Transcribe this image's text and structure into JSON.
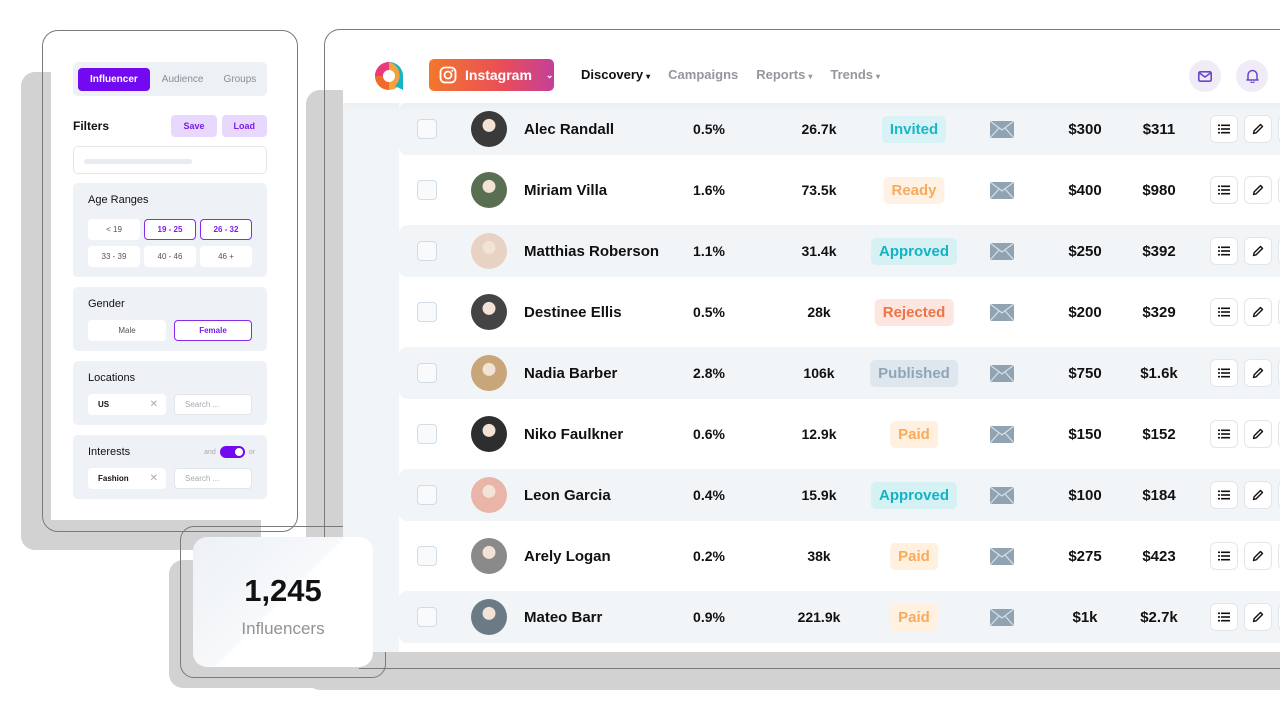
{
  "filters": {
    "tabs": [
      {
        "label": "Influencer",
        "active": true
      },
      {
        "label": "Audience",
        "active": false
      },
      {
        "label": "Groups",
        "active": false
      }
    ],
    "title": "Filters",
    "save_label": "Save",
    "load_label": "Load",
    "age": {
      "title": "Age Ranges",
      "options": [
        {
          "label": "< 19",
          "selected": false
        },
        {
          "label": "19 - 25",
          "selected": true
        },
        {
          "label": "26 - 32",
          "selected": true
        },
        {
          "label": "33 - 39",
          "selected": false
        },
        {
          "label": "40 - 46",
          "selected": false
        },
        {
          "label": "46 +",
          "selected": false
        }
      ]
    },
    "gender": {
      "title": "Gender",
      "options": [
        {
          "label": "Male",
          "selected": false
        },
        {
          "label": "Female",
          "selected": true
        }
      ]
    },
    "locations": {
      "title": "Locations",
      "tag": "US",
      "search_placeholder": "Search ..."
    },
    "interests": {
      "title": "Interests",
      "toggle_left": "and",
      "toggle_right": "or",
      "tag": "Fashion",
      "search_placeholder": "Search ..."
    }
  },
  "counter": {
    "value": "1,245",
    "label": "Influencers"
  },
  "header": {
    "platform": "Instagram",
    "nav": [
      {
        "label": "Discovery",
        "active": true,
        "dropdown": true
      },
      {
        "label": "Campaigns",
        "active": false,
        "dropdown": false
      },
      {
        "label": "Reports",
        "active": false,
        "dropdown": true
      },
      {
        "label": "Trends",
        "active": false,
        "dropdown": true
      }
    ],
    "icons": [
      "mail-icon",
      "bell-icon"
    ]
  },
  "status_colors": {
    "Invited": {
      "bg": "#d9f2f5",
      "fg": "#1bb7c9"
    },
    "Ready": {
      "bg": "#fff1e3",
      "fg": "#f7ab5c"
    },
    "Approved": {
      "bg": "#d5f1f4",
      "fg": "#12b3c4"
    },
    "Rejected": {
      "bg": "#fde6df",
      "fg": "#ee7346"
    },
    "Published": {
      "bg": "#dfe7ee",
      "fg": "#8ea5b8"
    },
    "Paid": {
      "bg": "#fff0e0",
      "fg": "#f7ab5c"
    }
  },
  "rows": [
    {
      "name": "Alec Randall",
      "engagement": "0.5%",
      "followers": "26.7k",
      "status": "Invited",
      "price": "$300",
      "total": "$311",
      "avatar": "#3a3a3a"
    },
    {
      "name": "Miriam Villa",
      "engagement": "1.6%",
      "followers": "73.5k",
      "status": "Ready",
      "price": "$400",
      "total": "$980",
      "avatar": "#5a6e52"
    },
    {
      "name": "Matthias Roberson",
      "engagement": "1.1%",
      "followers": "31.4k",
      "status": "Approved",
      "price": "$250",
      "total": "$392",
      "avatar": "#e8d2c4"
    },
    {
      "name": "Destinee Ellis",
      "engagement": "0.5%",
      "followers": "28k",
      "status": "Rejected",
      "price": "$200",
      "total": "$329",
      "avatar": "#444444"
    },
    {
      "name": "Nadia Barber",
      "engagement": "2.8%",
      "followers": "106k",
      "status": "Published",
      "price": "$750",
      "total": "$1.6k",
      "avatar": "#c9a67a"
    },
    {
      "name": "Niko Faulkner",
      "engagement": "0.6%",
      "followers": "12.9k",
      "status": "Paid",
      "price": "$150",
      "total": "$152",
      "avatar": "#2e2e2e"
    },
    {
      "name": "Leon Garcia",
      "engagement": "0.4%",
      "followers": "15.9k",
      "status": "Approved",
      "price": "$100",
      "total": "$184",
      "avatar": "#e9b5a8"
    },
    {
      "name": "Arely Logan",
      "engagement": "0.2%",
      "followers": "38k",
      "status": "Paid",
      "price": "$275",
      "total": "$423",
      "avatar": "#8a8a8a"
    },
    {
      "name": "Mateo Barr",
      "engagement": "0.9%",
      "followers": "221.9k",
      "status": "Paid",
      "price": "$1k",
      "total": "$2.7k",
      "avatar": "#6b7b86"
    }
  ]
}
